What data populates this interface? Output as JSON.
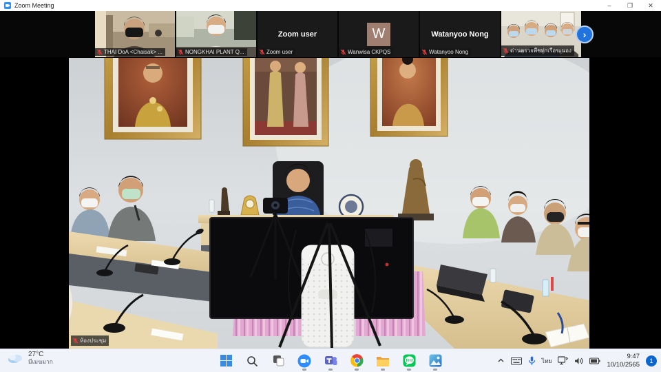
{
  "window": {
    "title": "Zoom Meeting",
    "controls": {
      "minimize": "–",
      "maximize": "❐",
      "close": "✕"
    }
  },
  "filmstrip": {
    "participants": [
      {
        "label": "THAI DoA <Chaisak> ...",
        "type": "video",
        "muted": true
      },
      {
        "label": "NONGKHAI PLANT Q...",
        "type": "video",
        "muted": true
      },
      {
        "label": "Zoom user",
        "display_name": "Zoom user",
        "type": "name",
        "muted": true
      },
      {
        "label": "Wanwisa CKPQS",
        "avatar_letter": "W",
        "type": "avatar",
        "muted": true,
        "avatar_color": "#a07f70"
      },
      {
        "label": "Watanyoo Nong",
        "display_name": "Watanyoo Nong",
        "type": "name",
        "muted": true
      },
      {
        "label": "ด่านตรวจพืชท่าเรือระนอง",
        "type": "video",
        "muted": true
      }
    ],
    "next_button_glyph": "›"
  },
  "main_video": {
    "label": "ห้องประชุม",
    "muted": true
  },
  "taskbar": {
    "weather": {
      "temp": "27°C",
      "condition": "มีเมฆมาก"
    },
    "apps": [
      "windows-start",
      "search",
      "task-view",
      "zoom",
      "teams",
      "chrome",
      "file-explorer",
      "line",
      "photos"
    ],
    "tray": {
      "language": "ไทย",
      "time": "9:47",
      "date": "10/10/2565",
      "notification_count": "1"
    }
  },
  "colors": {
    "zoom_blue": "#2d8cff",
    "next_button": "#2173de",
    "taskbar_bg": "#f0f3f9",
    "badge_blue": "#0b66d0"
  }
}
